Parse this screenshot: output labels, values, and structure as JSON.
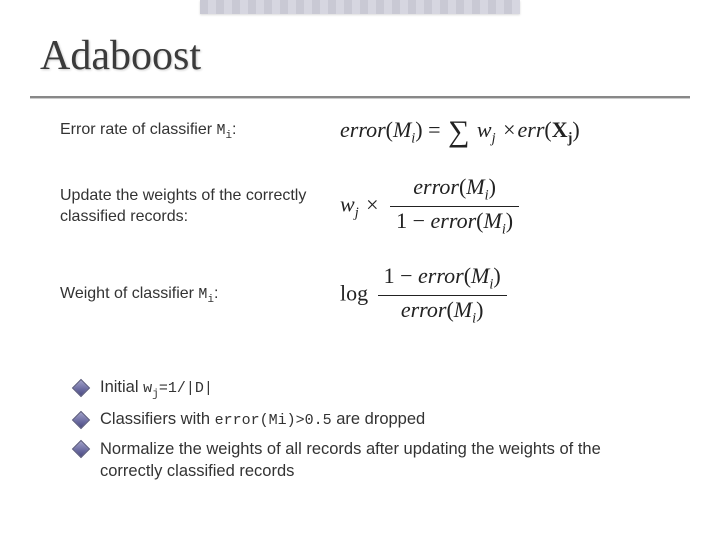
{
  "title": "Adaboost",
  "rows": {
    "r1": {
      "label_pre": "Error rate of classifier ",
      "label_code": "M",
      "label_sub": "i",
      "label_post": ":",
      "f_error": "error",
      "f_M": "M",
      "f_i": "i",
      "f_w": "w",
      "f_j": "j",
      "f_err": "err",
      "f_X": "X",
      "f_j2": "j"
    },
    "r2": {
      "label": "Update the weights of the correctly classified records:",
      "f_w": "w",
      "f_j": "j",
      "f_error": "error",
      "f_M": "M",
      "f_i": "i",
      "f_one": "1"
    },
    "r3": {
      "label_pre": "Weight of classifier ",
      "label_code": "M",
      "label_sub": "i",
      "label_post": ":",
      "f_log": "log",
      "f_error": "error",
      "f_M": "M",
      "f_i": "i",
      "f_one": "1"
    }
  },
  "bullets": {
    "b1_pre": "Initial ",
    "b1_code": "w",
    "b1_sub": "j",
    "b1_eq": "=1/|D|",
    "b2_pre": "Classifiers with ",
    "b2_code": "error(Mi)>0.5",
    "b2_post": " are dropped",
    "b3": "Normalize the weights of all records after updating the weights of the correctly classified records"
  }
}
